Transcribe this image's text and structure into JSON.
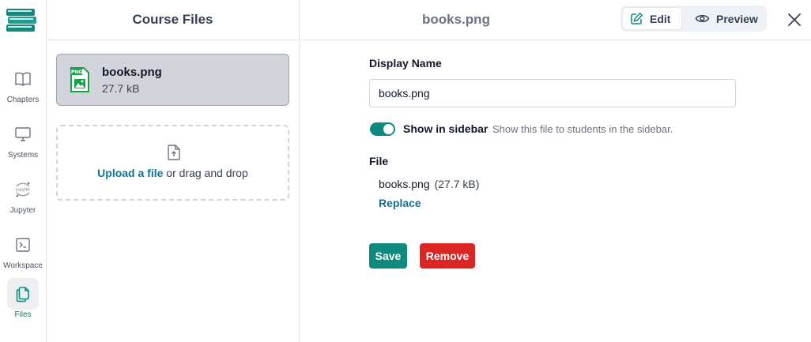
{
  "rail": {
    "items": [
      {
        "label": "Chapters",
        "icon": "book-open-icon"
      },
      {
        "label": "Systems",
        "icon": "monitor-icon"
      },
      {
        "label": "Jupyter",
        "icon": "jupyter-icon"
      },
      {
        "label": "Workspace",
        "icon": "terminal-icon"
      },
      {
        "label": "Files",
        "icon": "files-icon",
        "active": true
      }
    ],
    "jupyter_icon_text": "jupyter"
  },
  "files_pane": {
    "title": "Course Files",
    "files": [
      {
        "name": "books.png",
        "size": "27.7 kB",
        "type_badge": "PNG"
      }
    ],
    "upload": {
      "link": "Upload a file",
      "rest": " or drag and drop"
    }
  },
  "detail": {
    "title": "books.png",
    "edit_label": "Edit",
    "preview_label": "Preview",
    "display_name_label": "Display Name",
    "display_name_value": "books.png",
    "toggle_label": "Show in sidebar",
    "toggle_help": "Show this file to students in the sidebar.",
    "toggle_on": true,
    "file_label": "File",
    "file_name": "books.png",
    "file_size": "(27.7 kB)",
    "replace_label": "Replace",
    "save_label": "Save",
    "remove_label": "Remove"
  },
  "colors": {
    "accent": "#0f8a7e",
    "link": "#0e7490",
    "danger": "#dc2626",
    "selected_card": "#d1d5db"
  }
}
